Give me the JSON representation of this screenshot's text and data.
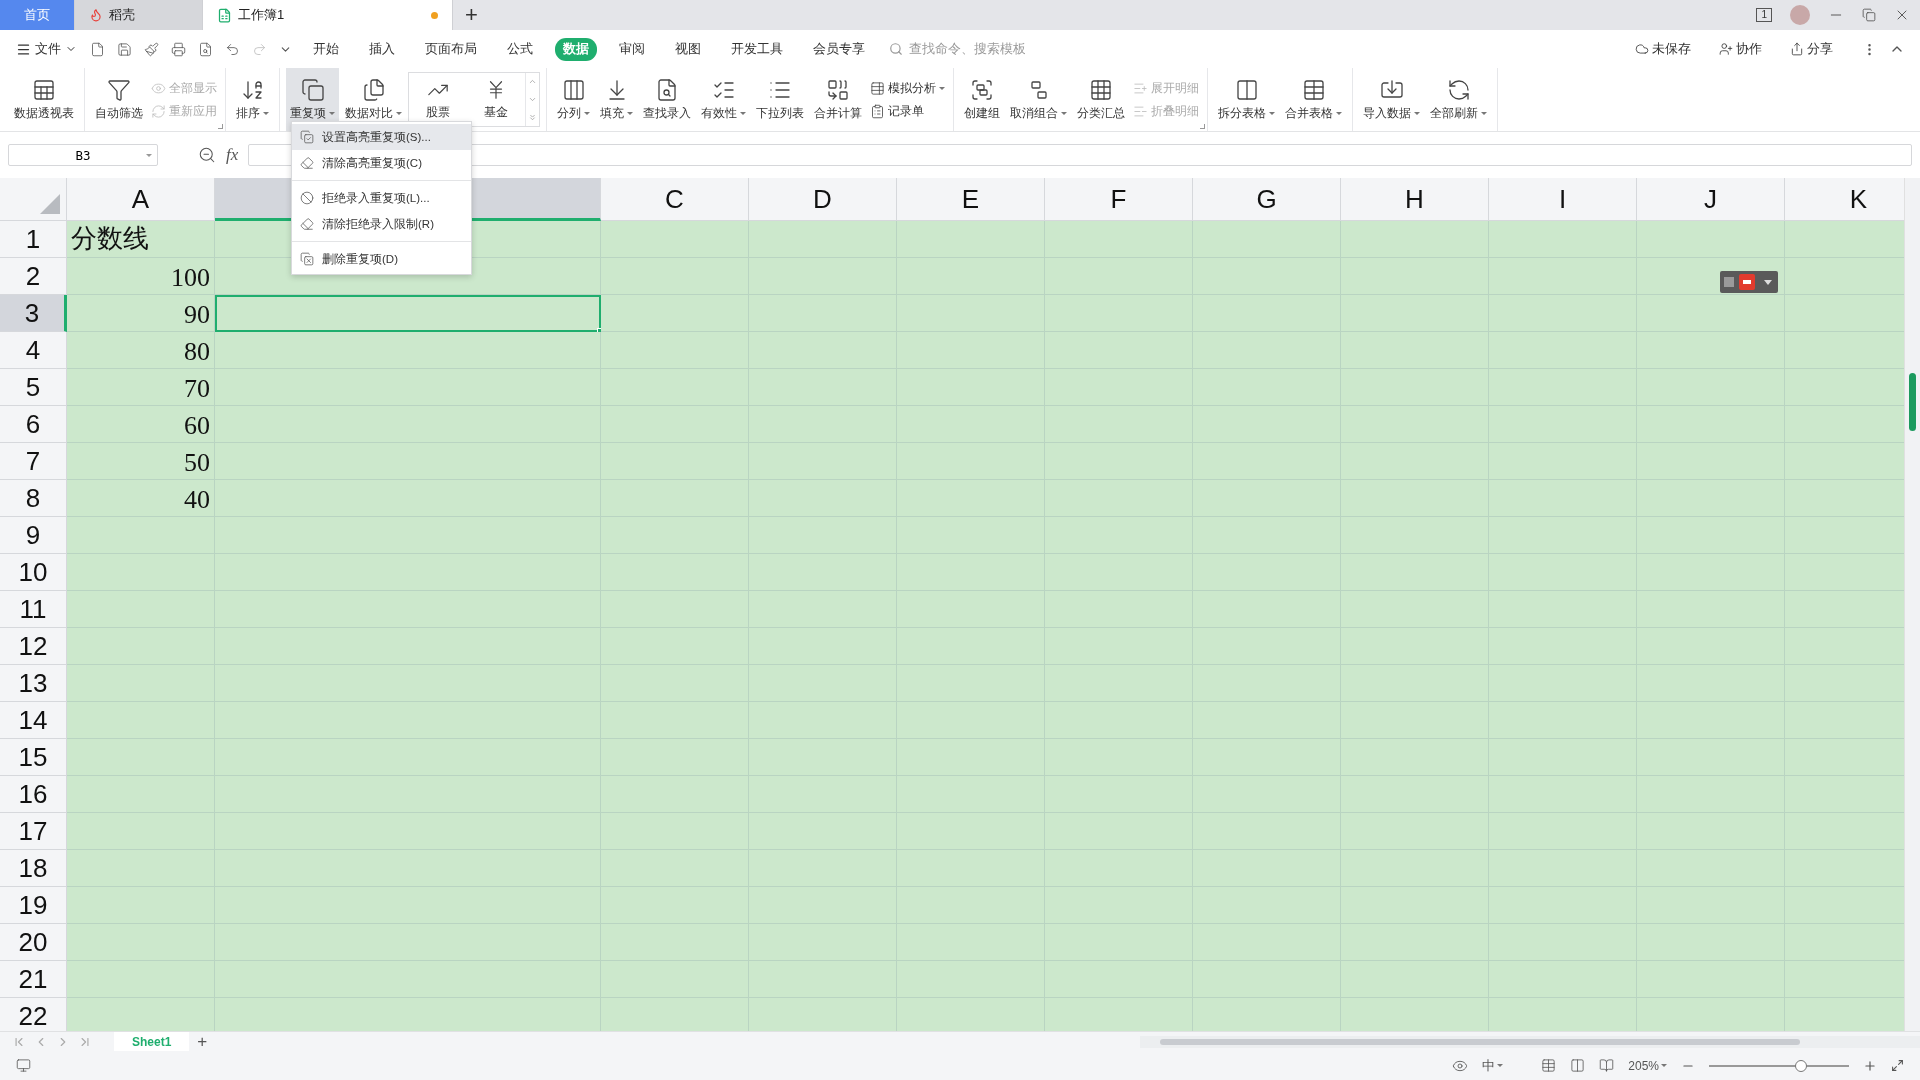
{
  "window": {
    "window_count": "1"
  },
  "tabs": [
    {
      "label": "首页",
      "kind": "home",
      "selected": false
    },
    {
      "label": "稻壳",
      "kind": "docer",
      "selected": false
    },
    {
      "label": "工作簿1",
      "kind": "sheet",
      "selected": true,
      "modified": true
    }
  ],
  "new_tab": "+",
  "menu": {
    "file": "文件",
    "tabs": [
      {
        "label": "开始",
        "selected": false
      },
      {
        "label": "插入",
        "selected": false
      },
      {
        "label": "页面布局",
        "selected": false
      },
      {
        "label": "公式",
        "selected": false
      },
      {
        "label": "数据",
        "selected": true
      },
      {
        "label": "审阅",
        "selected": false
      },
      {
        "label": "视图",
        "selected": false
      },
      {
        "label": "开发工具",
        "selected": false
      },
      {
        "label": "会员专享",
        "selected": false
      }
    ],
    "search": {
      "placeholder": "查找命令、搜索模板"
    },
    "actions": [
      "未保存",
      "协作",
      "分享"
    ]
  },
  "ribbon": {
    "groups": [
      {
        "entries": [
          {
            "kind": "large",
            "label": "数据透视表",
            "dropdown": false,
            "pressed": false
          }
        ]
      },
      {
        "launcher": true,
        "entries": [
          {
            "kind": "large",
            "label": "自动筛选",
            "dropdown": false,
            "pressed": false
          },
          {
            "kind": "stack",
            "items": [
              {
                "label": "全部显示",
                "disabled": true
              },
              {
                "label": "重新应用",
                "disabled": true
              }
            ]
          }
        ]
      },
      {
        "entries": [
          {
            "kind": "large",
            "label": "排序",
            "dropdown": true,
            "pressed": false
          }
        ]
      },
      {
        "entries": [
          {
            "kind": "large",
            "label": "重复项",
            "dropdown": true,
            "pressed": true
          },
          {
            "kind": "large",
            "label": "数据对比",
            "dropdown": true,
            "pressed": false
          },
          {
            "kind": "gallery",
            "items": [
              {
                "label": "股票"
              },
              {
                "label": "基金"
              }
            ]
          }
        ]
      },
      {
        "entries": [
          {
            "kind": "large",
            "label": "分列",
            "dropdown": true,
            "pressed": false
          },
          {
            "kind": "large",
            "label": "填充",
            "dropdown": true,
            "pressed": false
          },
          {
            "kind": "large",
            "label": "查找录入",
            "dropdown": false,
            "pressed": false
          },
          {
            "kind": "large",
            "label": "有效性",
            "dropdown": true,
            "pressed": false
          },
          {
            "kind": "large",
            "label": "下拉列表",
            "dropdown": false,
            "pressed": false
          },
          {
            "kind": "large",
            "label": "合并计算",
            "dropdown": false,
            "pressed": false
          },
          {
            "kind": "stack",
            "items": [
              {
                "label": "模拟分析",
                "disabled": false,
                "dropdown": true
              },
              {
                "label": "记录单",
                "disabled": false,
                "dropdown": false
              }
            ]
          }
        ]
      },
      {
        "launcher": true,
        "entries": [
          {
            "kind": "large",
            "label": "创建组",
            "dropdown": false,
            "pressed": false
          },
          {
            "kind": "large",
            "label": "取消组合",
            "dropdown": true,
            "pressed": false
          },
          {
            "kind": "large",
            "label": "分类汇总",
            "dropdown": false,
            "pressed": false
          },
          {
            "kind": "stack",
            "items": [
              {
                "label": "展开明细",
                "disabled": true,
                "dropdown": false
              },
              {
                "label": "折叠明细",
                "disabled": true,
                "dropdown": false
              }
            ]
          }
        ]
      },
      {
        "entries": [
          {
            "kind": "large",
            "label": "拆分表格",
            "dropdown": true,
            "pressed": false
          },
          {
            "kind": "large",
            "label": "合并表格",
            "dropdown": true,
            "pressed": false
          }
        ]
      },
      {
        "entries": [
          {
            "kind": "large",
            "label": "导入数据",
            "dropdown": true,
            "pressed": false
          },
          {
            "kind": "large",
            "label": "全部刷新",
            "dropdown": true,
            "pressed": false
          }
        ]
      }
    ]
  },
  "formula_bar": {
    "name_box": "B3",
    "fx": "fx"
  },
  "duplicates_menu": {
    "sections": [
      {
        "items": [
          {
            "label": "设置高亮重复项(S)...",
            "selected": true
          },
          {
            "label": "清除高亮重复项(C)",
            "selected": false
          }
        ]
      },
      {
        "items": [
          {
            "label": "拒绝录入重复项(L)...",
            "selected": false
          },
          {
            "label": "清除拒绝录入限制(R)",
            "selected": false
          }
        ]
      },
      {
        "items": [
          {
            "label": "删除重复项(D)",
            "selected": false
          }
        ]
      }
    ]
  },
  "sheet": {
    "columns": [
      {
        "label": "A",
        "selected": false
      },
      {
        "selected": true
      },
      {
        "label": "C",
        "selected": false
      },
      {
        "label": "D",
        "selected": false
      },
      {
        "label": "E",
        "selected": false
      },
      {
        "label": "F",
        "selected": false
      },
      {
        "label": "G",
        "selected": false
      },
      {
        "label": "H",
        "selected": false
      },
      {
        "label": "I",
        "selected": false
      },
      {
        "label": "J",
        "selected": false
      },
      {
        "label": "K",
        "selected": false
      }
    ],
    "rows": [
      {
        "label": "1",
        "selected": false,
        "cells": [
          {
            "value": "分数线",
            "kind": "text",
            "selected": false
          }
        ]
      },
      {
        "label": "2",
        "selected": false,
        "cells": [
          {
            "value": "100",
            "kind": "number",
            "selected": false
          }
        ]
      },
      {
        "label": "3",
        "selected": true,
        "cells": [
          {
            "value": "90",
            "kind": "number",
            "selected": false
          },
          {
            "selected": true
          }
        ]
      },
      {
        "label": "4",
        "selected": false,
        "cells": [
          {
            "value": "80",
            "kind": "number",
            "selected": false
          }
        ]
      },
      {
        "label": "5",
        "selected": false,
        "cells": [
          {
            "value": "70",
            "kind": "number",
            "selected": false
          }
        ]
      },
      {
        "label": "6",
        "selected": false,
        "cells": [
          {
            "value": "60",
            "kind": "number",
            "selected": false
          }
        ]
      },
      {
        "label": "7",
        "selected": false,
        "cells": [
          {
            "value": "50",
            "kind": "number",
            "selected": false
          }
        ]
      },
      {
        "label": "8",
        "selected": false,
        "cells": [
          {
            "value": "40",
            "kind": "number",
            "selected": false
          }
        ]
      },
      {
        "label": "9",
        "selected": false
      },
      {
        "label": "10",
        "selected": false
      },
      {
        "label": "11",
        "selected": false
      },
      {
        "label": "12",
        "selected": false
      },
      {
        "label": "13",
        "selected": false
      },
      {
        "label": "14",
        "selected": false
      },
      {
        "label": "15",
        "selected": false
      },
      {
        "label": "16",
        "selected": false
      },
      {
        "label": "17",
        "selected": false
      },
      {
        "label": "18",
        "selected": false
      },
      {
        "label": "19",
        "selected": false
      },
      {
        "label": "20",
        "selected": false
      },
      {
        "label": "21",
        "selected": false
      },
      {
        "label": "22",
        "selected": false
      }
    ]
  },
  "sheet_tabs": {
    "tabs": [
      {
        "label": "Sheet1",
        "selected": true
      }
    ],
    "add": "+"
  },
  "status_bar": {
    "input_mode": "中",
    "zoom": "205%",
    "zoom_slider": {
      "level": 0.66
    }
  }
}
